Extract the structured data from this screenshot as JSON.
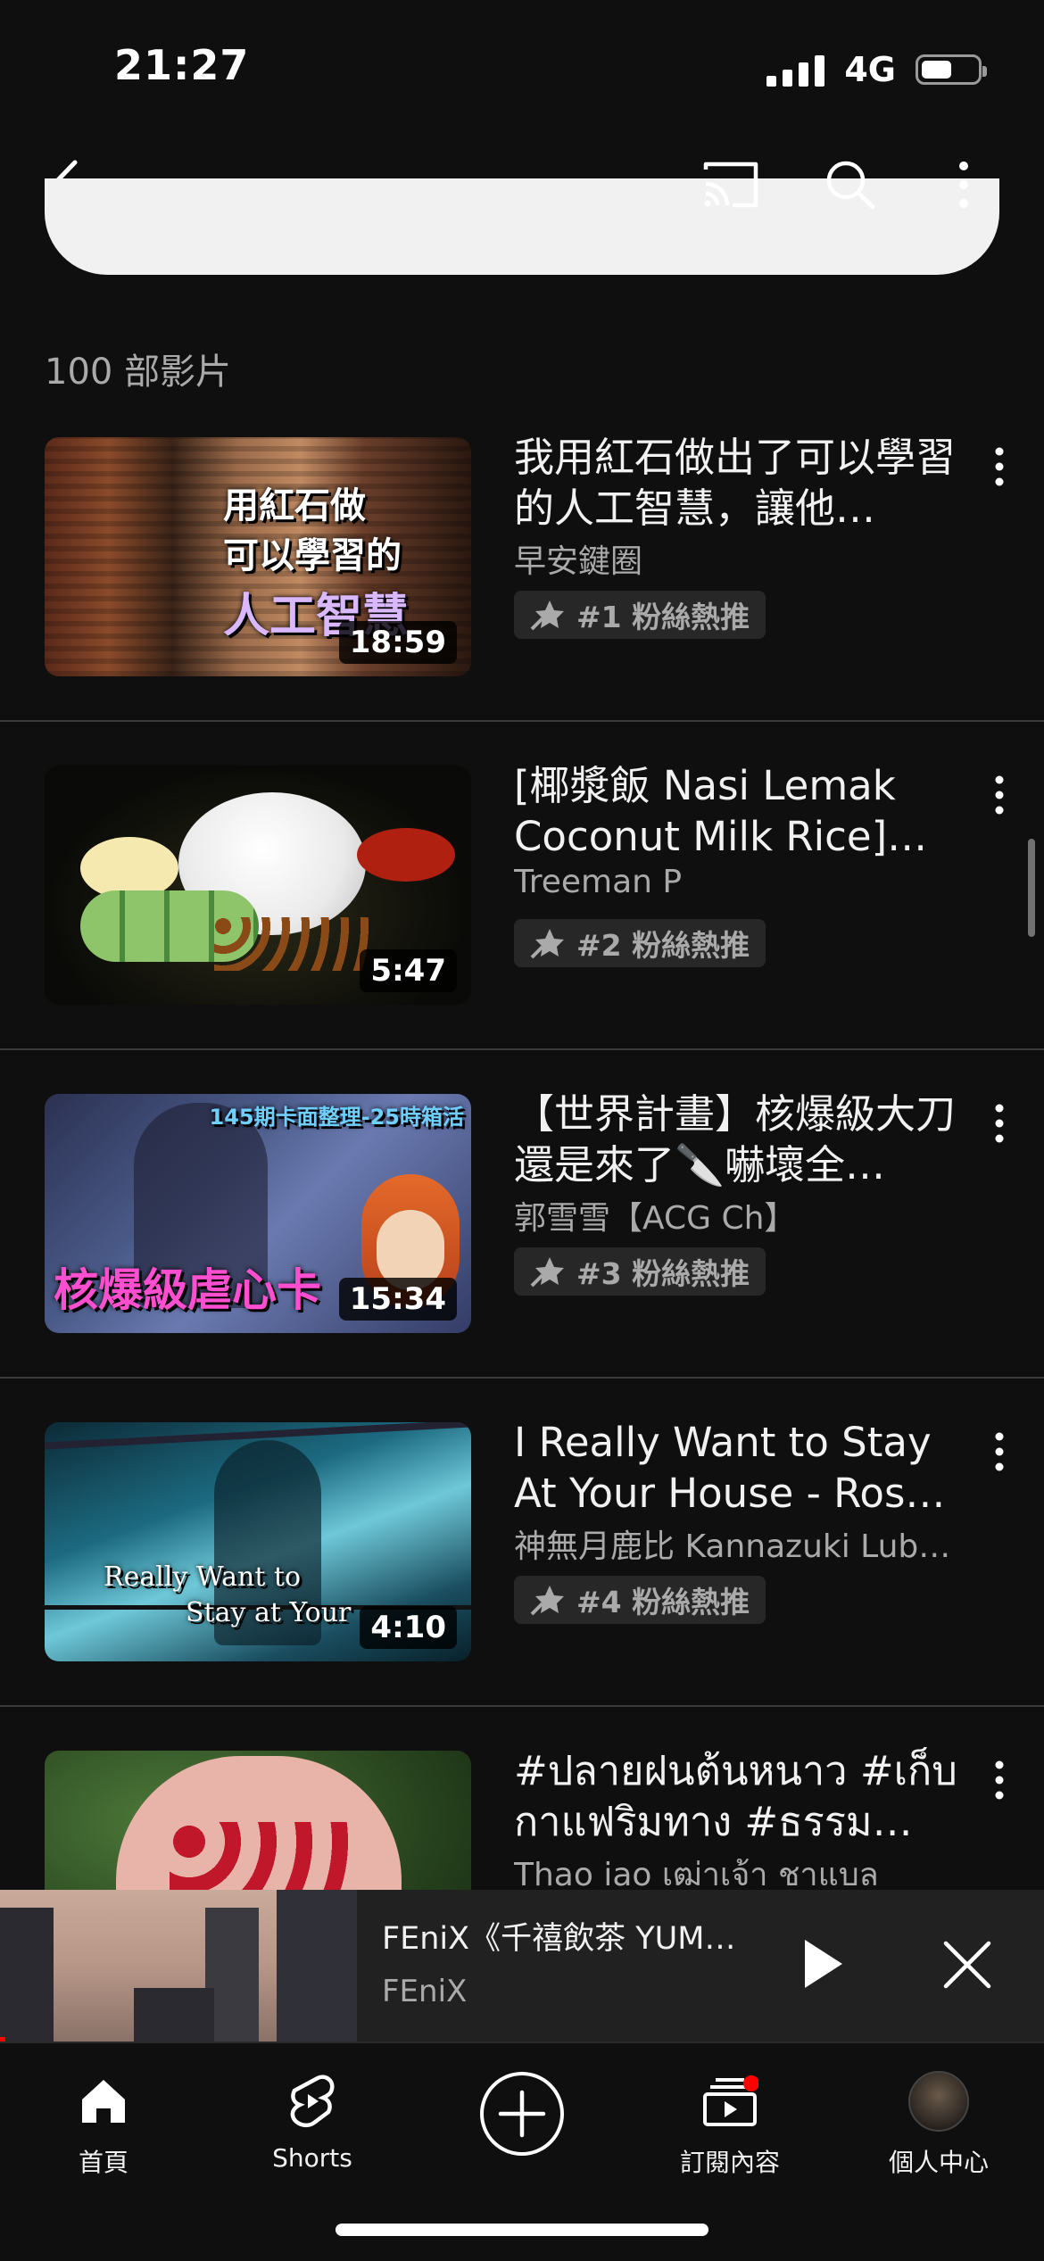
{
  "status_bar": {
    "time": "21:27",
    "network": "4G",
    "battery_level_percent": 55
  },
  "top_bar": {
    "back_icon": "chevron-left-icon",
    "cast_icon": "cast-icon",
    "search_icon": "search-icon",
    "more_icon": "more-vert-icon"
  },
  "section": {
    "count_label": "100 部影片"
  },
  "videos": [
    {
      "title": "我用紅石做出了可以學習的人工智慧，讓他…",
      "channel": "早安鍵圈",
      "duration": "18:59",
      "badge": "#1 粉絲熱推",
      "thumb_overlay": [
        "用紅石做",
        "可以學習的",
        "人工智慧"
      ]
    },
    {
      "title": "[椰漿飯 Nasi Lemak Coconut Milk Rice]…",
      "channel": "Treeman P",
      "duration": "5:47",
      "badge": "#2 粉絲熱推"
    },
    {
      "title": "【世界計畫】核爆級大刀還是來了🔪嚇壞全…",
      "channel": "郭雪雪【ACG Ch】",
      "duration": "15:34",
      "badge": "#3 粉絲熱推",
      "thumb_overlay": [
        "145期卡面整理-25時箱活",
        "核爆級虐心卡"
      ]
    },
    {
      "title": "I Really Want to Stay At Your House - Rosa W…",
      "channel": "神無月鹿比 Kannazuki Lub…",
      "duration": "4:10",
      "badge": "#4 粉絲熱推",
      "thumb_overlay": [
        "Really Want to",
        "Stay at Your"
      ]
    },
    {
      "title": "#ปลายฝนต้นหนาว #เก็บกาแฟริมทาง #ธรรมชา…",
      "channel": "Thao iao เฒ่าเจ้า ชาแบล",
      "duration": "",
      "badge": ""
    }
  ],
  "mini_player": {
    "title": "FEniX《千禧飲茶 YUM…",
    "channel": "FEniX",
    "play_icon": "play-icon",
    "close_icon": "close-icon"
  },
  "bottom_nav": {
    "items": [
      {
        "label": "首頁",
        "icon": "home-icon"
      },
      {
        "label": "Shorts",
        "icon": "shorts-icon"
      },
      {
        "label": "",
        "icon": "create-plus-icon"
      },
      {
        "label": "訂閱內容",
        "icon": "subscriptions-icon"
      },
      {
        "label": "個人中心",
        "icon": "avatar"
      }
    ]
  },
  "colors": {
    "background": "#0f0f0f",
    "accent_red": "#ff0000",
    "text_secondary": "#aaaaaa"
  }
}
